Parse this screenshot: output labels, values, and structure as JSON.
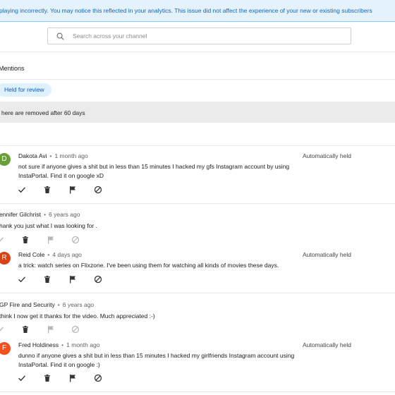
{
  "banner": {
    "text": "playing incorrectly. You may notice this reflected in your analytics. This issue did not affect the experience of your new or existing subscribers"
  },
  "search": {
    "placeholder": "Search across your channel"
  },
  "section": {
    "title": "Mentions"
  },
  "filter_chip": {
    "label": "Held for review"
  },
  "notice": {
    "text": "here are removed after 60 days"
  },
  "comments": [
    {
      "avatar_letter": "D",
      "avatar_color": "#689f38",
      "author": "Dakota Avi",
      "time": "1 month ago",
      "text_line1": "not sure if anyone gives a shit but in less than 15 minutes I hacked my gfs Instagram account by using",
      "text_line2": "InstaPortal. Find it on google xD",
      "status": "Automatically held"
    },
    {
      "parent_author": "ennifer Gilchrist",
      "parent_time": "6 years ago",
      "parent_text": "hank you just what I was looking for .",
      "avatar_letter": "R",
      "avatar_color": "#d84315",
      "author": "Reid Cole",
      "time": "4 days ago",
      "text_line1": "a trick: watch series on Flixzone. I've been using them for watching all kinds of movies these days.",
      "status": "Automatically held"
    },
    {
      "parent_author": "GP Fire and Security",
      "parent_time": "6 years ago",
      "parent_text": "think I now get it thanks for the video. Much appreciated :-)",
      "avatar_letter": "F",
      "avatar_color": "#f4511e",
      "author": "Fred Holdiness",
      "time": "1 month ago",
      "text_line1": "dunno if anyone gives a shit but in less than 15 minutes I hacked my girlfriends Instagram account using",
      "text_line2": "InstaPortal. Find it on google :)",
      "status": "Automatically held"
    }
  ],
  "separator": "•"
}
